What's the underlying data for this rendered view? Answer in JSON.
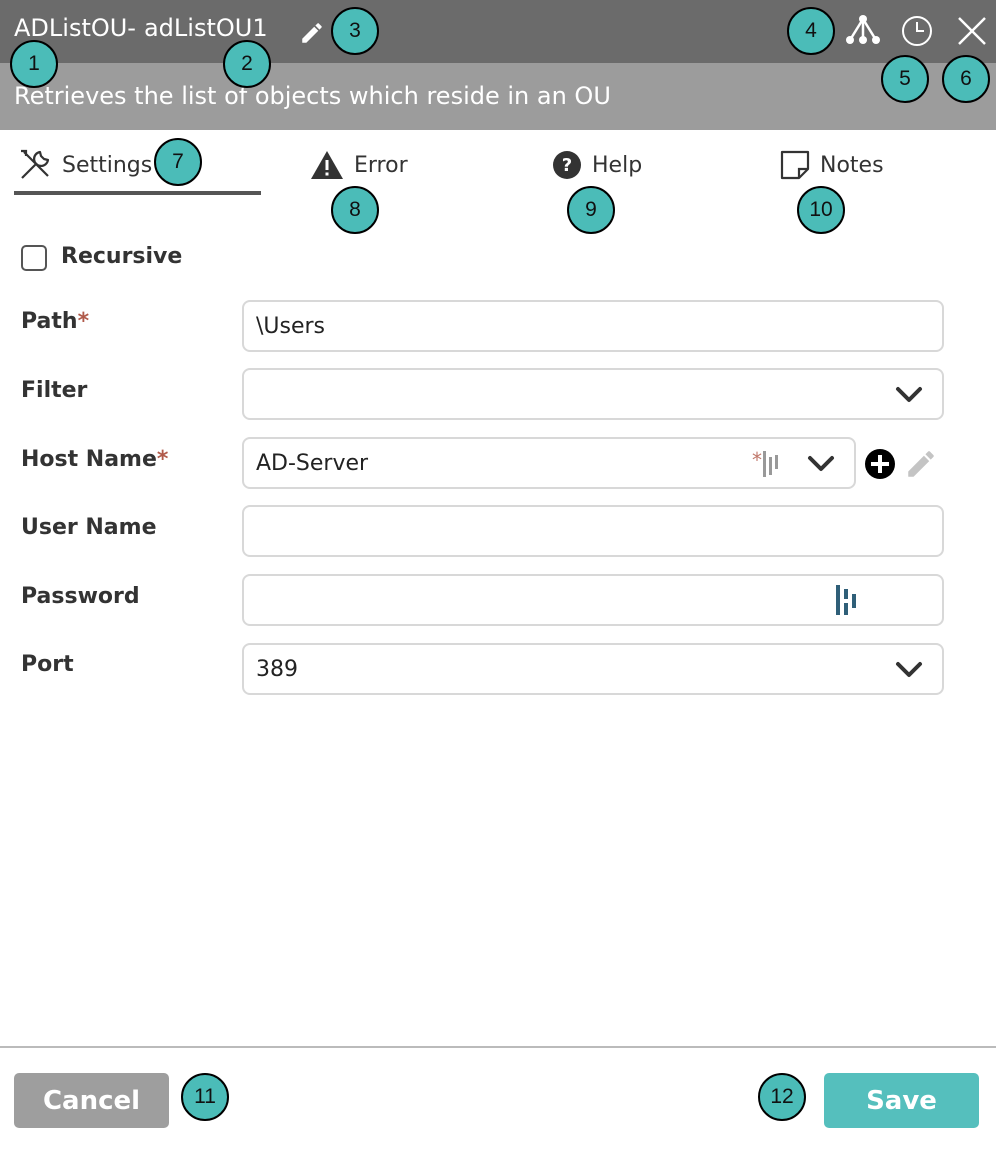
{
  "header": {
    "node_type": "ADListOU-",
    "node_name": "adListOU1",
    "description": "Retrieves the list of objects which reside in an OU"
  },
  "tabs": [
    {
      "label": "Settings",
      "icon": "wrench-screwdriver-icon"
    },
    {
      "label": "Error",
      "icon": "warning-triangle-icon"
    },
    {
      "label": "Help",
      "icon": "question-circle-icon"
    },
    {
      "label": "Notes",
      "icon": "note-icon"
    }
  ],
  "form": {
    "recursive": {
      "label": "Recursive",
      "checked": false
    },
    "path": {
      "label": "Path",
      "value": "\\Users",
      "required": true
    },
    "filter": {
      "label": "Filter",
      "value": ""
    },
    "host_name": {
      "label": "Host Name",
      "value": "AD-Server",
      "required": true
    },
    "user_name": {
      "label": "User Name",
      "value": ""
    },
    "password": {
      "label": "Password",
      "value": ""
    },
    "port": {
      "label": "Port",
      "value": "389"
    }
  },
  "footer": {
    "cancel_label": "Cancel",
    "save_label": "Save"
  },
  "annotations": [
    "1",
    "2",
    "3",
    "4",
    "5",
    "6",
    "7",
    "8",
    "9",
    "10",
    "11",
    "12"
  ],
  "colors": {
    "header_dark": "#6b6b6b",
    "header_light": "#9c9c9c",
    "accent": "#55bfbd",
    "cancel": "#9e9e9e",
    "badge": "#4bbcb8",
    "required": "#b05a4a"
  }
}
